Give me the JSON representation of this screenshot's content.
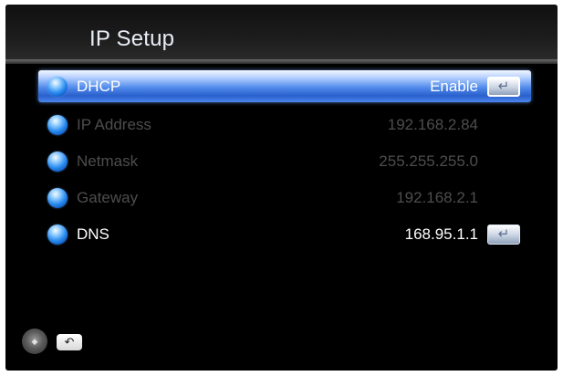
{
  "header": {
    "title": "IP Setup"
  },
  "settings": [
    {
      "label": "DHCP",
      "value": "Enable",
      "state": "highlighted",
      "enter_icon": "enter-return-icon"
    },
    {
      "label": "IP Address",
      "value": "192.168.2.84",
      "state": "dimmed"
    },
    {
      "label": "Netmask",
      "value": "255.255.255.0",
      "state": "dimmed"
    },
    {
      "label": "Gateway",
      "value": "192.168.2.1",
      "state": "dimmed"
    },
    {
      "label": "DNS",
      "value": "168.95.1.1",
      "state": "active",
      "enter_icon": "enter-return-icon"
    }
  ],
  "footer": {
    "icons": [
      "directional-pad-icon",
      "back-return-icon"
    ]
  },
  "colors": {
    "background": "#000000",
    "highlight": "#4f89ea",
    "text_active": "#ffffff",
    "text_dimmed": "#4d4d4d"
  }
}
